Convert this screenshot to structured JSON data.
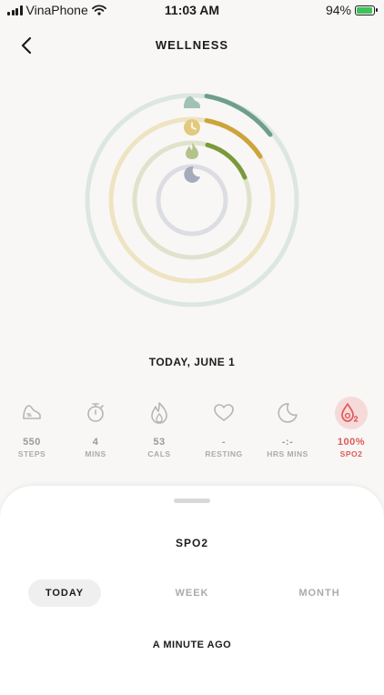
{
  "status_bar": {
    "carrier": "VinaPhone",
    "time": "11:03 AM",
    "battery": "94%",
    "battery_color": "#3ec25a"
  },
  "header": {
    "title": "WELLNESS",
    "back_icon": "chevron-left-icon"
  },
  "rings": {
    "colors": {
      "steps": "#6e9e8e",
      "minutes": "#cda43a",
      "calories": "#7a9a3a",
      "sleep": "#a7aabb"
    },
    "icons": [
      "shoe-icon",
      "clock-icon",
      "flame-icon",
      "moon-icon"
    ]
  },
  "date_label": "TODAY, JUNE 1",
  "metrics": [
    {
      "value": "550",
      "label": "STEPS",
      "icon": "shoe-icon"
    },
    {
      "value": "4",
      "label": "MINS",
      "icon": "stopwatch-icon"
    },
    {
      "value": "53",
      "label": "CALS",
      "icon": "flame-icon"
    },
    {
      "value": "-",
      "label": "RESTING",
      "icon": "heart-icon"
    },
    {
      "value": "-:-",
      "label": "HRS MINS",
      "icon": "moon-icon"
    },
    {
      "value": "100%",
      "label": "SPO2",
      "icon": "oxygen-drop-icon",
      "active": true
    }
  ],
  "accent_color": "#e05a5a",
  "sheet": {
    "title": "SPO2",
    "tabs": [
      {
        "label": "TODAY",
        "active": true
      },
      {
        "label": "WEEK"
      },
      {
        "label": "MONTH"
      }
    ],
    "last_updated": "A MINUTE AGO"
  }
}
